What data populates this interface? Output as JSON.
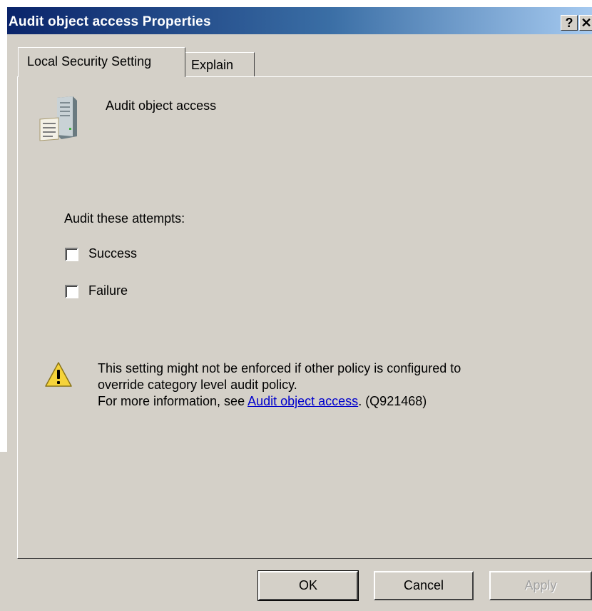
{
  "window": {
    "title": "Audit object access Properties",
    "help_label": "?",
    "close_label": "✕"
  },
  "tabs": [
    {
      "label": "Local Security Setting",
      "active": true
    },
    {
      "label": "Explain",
      "active": false
    }
  ],
  "policy": {
    "name": "Audit object access",
    "icon": "server-policy-icon"
  },
  "audit": {
    "label": "Audit these attempts:",
    "options": [
      {
        "label": "Success",
        "checked": false
      },
      {
        "label": "Failure",
        "checked": false
      }
    ]
  },
  "warning": {
    "icon": "warning-icon",
    "line1": "This setting might not be enforced if other policy is configured to",
    "line2": "override category level audit policy.",
    "line3_prefix": "For more information, see ",
    "link_text": "Audit object access",
    "line3_suffix": ". (Q921468)"
  },
  "buttons": {
    "ok": "OK",
    "cancel": "Cancel",
    "apply": "Apply"
  },
  "colors": {
    "title_bar_start": "#0a246a",
    "title_bar_end": "#a6caf0",
    "face": "#d4d0c8",
    "link": "#0000cc"
  }
}
